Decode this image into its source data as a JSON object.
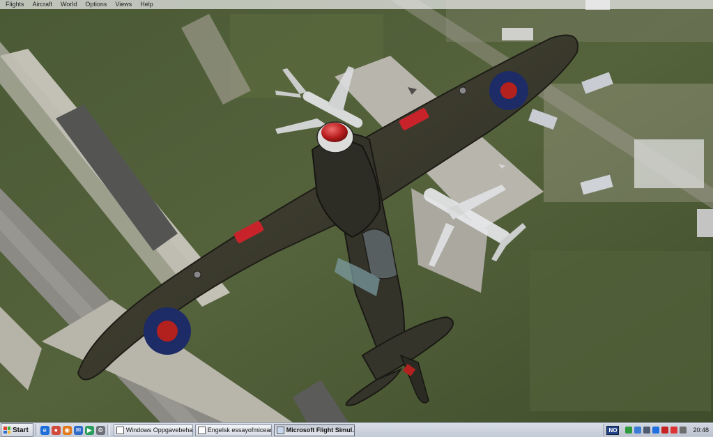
{
  "window": {
    "title": "Microsoft Flight Simulator X"
  },
  "menu": {
    "items": [
      "Flights",
      "Aircraft",
      "World",
      "Options",
      "Views",
      "Help"
    ]
  },
  "taskbar": {
    "start_label": "Start",
    "quick_launch": [
      {
        "icon": "ie-icon",
        "color": "#1e6fd9",
        "glyph": "e"
      },
      {
        "icon": "chrome-icon",
        "color": "#d24a3a",
        "glyph": "●"
      },
      {
        "icon": "firefox-icon",
        "color": "#e07a1c",
        "glyph": "◉"
      },
      {
        "icon": "outlook-icon",
        "color": "#2e6bc6",
        "glyph": "✉"
      },
      {
        "icon": "media-player-icon",
        "color": "#2a9d5a",
        "glyph": "▶"
      },
      {
        "icon": "settings-icon",
        "color": "#6c6f78",
        "glyph": "⚙"
      }
    ],
    "tasks": [
      {
        "label": "Windows Oppgavebehan...",
        "active": false
      },
      {
        "label": "Engelsk essayofmiceand...",
        "active": false
      },
      {
        "label": "Microsoft Flight Simul...",
        "active": true
      }
    ],
    "language": "NO",
    "tray_icons": [
      {
        "icon": "network-icon",
        "color": "#2e9a3b"
      },
      {
        "icon": "security-icon",
        "color": "#3a7bd5"
      },
      {
        "icon": "volume-icon",
        "color": "#4d5a70"
      },
      {
        "icon": "update-icon",
        "color": "#1f6fe0"
      },
      {
        "icon": "antivirus-icon",
        "color": "#c82323"
      },
      {
        "icon": "chat-icon",
        "color": "#d33"
      },
      {
        "icon": "clock-settings-icon",
        "color": "#6d6d6d"
      }
    ],
    "clock": "20:48"
  },
  "colors": {
    "roundel_blue": "#1d2b66",
    "roundel_red": "#b3211e",
    "airframe": "#3b3a2e",
    "grass": "#4b5a35",
    "taxiway": "#b9b7ad",
    "accent_red": "#c8232a"
  }
}
